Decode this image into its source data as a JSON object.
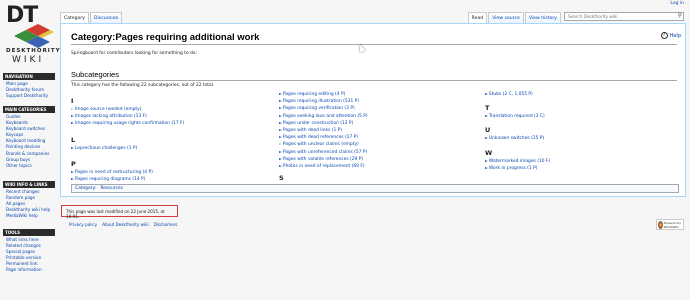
{
  "login": "Log in",
  "logo": {
    "letters": "DT",
    "word1": "DESKTHORITY",
    "word2": "WIKI"
  },
  "sidebar": {
    "navigation": {
      "title": "NAVIGATION",
      "items": [
        "Main page",
        "Deskthority forum",
        "Support Deskthority"
      ]
    },
    "main_categories": {
      "title": "MAIN CATEGORIES",
      "items": [
        "Guides",
        "Keyboards",
        "Keyboard switches",
        "Keycaps",
        "Keyboard modding",
        "Pointing devices",
        "Brands & companies",
        "Group buys",
        "Other topics"
      ]
    },
    "wiki_info": {
      "title": "WIKI INFO & LINKS",
      "items": [
        "Recent changes",
        "Random page",
        "All pages",
        "Deskthority wiki help",
        "MediaWiki help"
      ]
    },
    "tools": {
      "title": "TOOLS",
      "items": [
        "What links here",
        "Related changes",
        "Special pages",
        "Printable version",
        "Permanent link",
        "Page information"
      ]
    }
  },
  "tabs": {
    "left": [
      "Category",
      "Discussion"
    ],
    "right": [
      "Read",
      "View source",
      "View history"
    ]
  },
  "search": {
    "placeholder": "Search Deskthority wiki"
  },
  "page": {
    "title": "Category:Pages requiring additional work",
    "help": "Help",
    "description": "Springboard for contributors looking for something to do:",
    "subcategories_heading": "Subcategories",
    "count_text": "This category has the following 22 subcategories, out of 22 total.",
    "columns": [
      [
        {
          "letter": "I",
          "items": [
            {
              "text": "Image source needed (empty)",
              "dim": true
            },
            {
              "text": "Images lacking attribution (13 F)",
              "dim": false
            },
            {
              "text": "Images requiring usage rights confirmation (17 F)",
              "dim": false
            }
          ]
        },
        {
          "letter": "L",
          "items": [
            {
              "text": "Leprechaun challenges (1 P)",
              "dim": false
            }
          ]
        },
        {
          "letter": "P",
          "items": [
            {
              "text": "Pages in need of restructuring (4 P)",
              "dim": false
            },
            {
              "text": "Pages requiring diagrams (14 P)",
              "dim": false
            }
          ]
        }
      ],
      [
        {
          "letter": "",
          "items": [
            {
              "text": "Pages requiring editing (4 P)",
              "dim": false
            },
            {
              "text": "Pages requiring illustration (531 P)",
              "dim": false
            },
            {
              "text": "Pages requiring verification (3 P)",
              "dim": false
            },
            {
              "text": "Pages seeking love and attention (5 P)",
              "dim": false
            },
            {
              "text": "Pages under construction (12 P)",
              "dim": false
            },
            {
              "text": "Pages with dead links (1 P)",
              "dim": false
            },
            {
              "text": "Pages with dead references (17 P)",
              "dim": false
            },
            {
              "text": "Pages with unclear claims (empty)",
              "dim": true
            },
            {
              "text": "Pages with unreferenced claims (57 P)",
              "dim": false
            },
            {
              "text": "Pages with volatile references (29 P)",
              "dim": false
            },
            {
              "text": "Photos in need of replacement (69 F)",
              "dim": false
            }
          ]
        },
        {
          "letter": "S",
          "items": []
        }
      ],
      [
        {
          "letter": "",
          "items": [
            {
              "text": "Stubs (2 C, 1,055 P)",
              "dim": false
            }
          ]
        },
        {
          "letter": "T",
          "items": [
            {
              "text": "Translation required (3 C)",
              "dim": false
            }
          ]
        },
        {
          "letter": "U",
          "items": [
            {
              "text": "Unknown switches (25 P)",
              "dim": false
            }
          ]
        },
        {
          "letter": "W",
          "items": [
            {
              "text": "Watermarked images (10 F)",
              "dim": false
            },
            {
              "text": "Work in progress (1 P)",
              "dim": false
            }
          ]
        }
      ]
    ],
    "categories_label": "Category:",
    "categories_link": "Resources"
  },
  "footer": {
    "last_modified": "This page was last modified on 22 June 2015, at 16:01.",
    "links": [
      "Privacy policy",
      "About Deskthority wiki",
      "Disclaimers"
    ],
    "badge": "Powered by MediaWiki"
  }
}
